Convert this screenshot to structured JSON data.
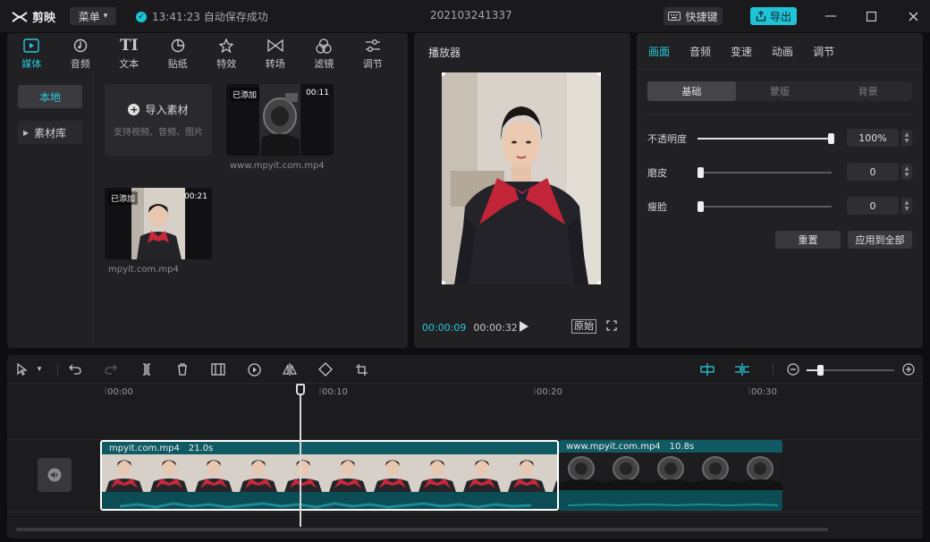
{
  "titlebar": {
    "app_name": "剪映",
    "menu_label": "菜单",
    "autosave_text": "13:41:23 自动保存成功",
    "project_name": "202103241337",
    "shortcut_label": "快捷键",
    "export_label": "导出"
  },
  "media": {
    "tabs": [
      {
        "label": "媒体",
        "icon": "media-icon",
        "active": true
      },
      {
        "label": "音频",
        "icon": "audio-icon"
      },
      {
        "label": "文本",
        "icon": "text-icon"
      },
      {
        "label": "贴纸",
        "icon": "sticker-icon"
      },
      {
        "label": "特效",
        "icon": "effects-icon"
      },
      {
        "label": "转场",
        "icon": "transition-icon"
      },
      {
        "label": "滤镜",
        "icon": "filter-icon"
      },
      {
        "label": "调节",
        "icon": "adjust-icon"
      }
    ],
    "side": {
      "local": "本地",
      "library": "素材库"
    },
    "import": {
      "title": "导入素材",
      "hint": "支持视频、音频、图片"
    },
    "items": [
      {
        "badge": "已添加",
        "duration": "00:11",
        "filename": "www.mpyit.com.mp4"
      },
      {
        "badge": "已添加",
        "duration": "00:21",
        "filename": "mpyit.com.mp4"
      }
    ]
  },
  "player": {
    "title": "播放器",
    "current_time": "00:00:09",
    "total_time": "00:00:32",
    "original_label": "原始"
  },
  "properties": {
    "tabs": [
      "画面",
      "音频",
      "变速",
      "动画",
      "调节"
    ],
    "subtabs": [
      "基础",
      "蒙版",
      "背景"
    ],
    "rows": [
      {
        "label": "不透明度",
        "value": "100%",
        "level": 1.0
      },
      {
        "label": "磨皮",
        "value": "0",
        "level": 0
      },
      {
        "label": "瘦脸",
        "value": "0",
        "level": 0
      }
    ],
    "reset_label": "重置",
    "apply_all_label": "应用到全部"
  },
  "timeline": {
    "ruler": [
      "00:00",
      "00:10",
      "00:20",
      "00:30"
    ],
    "clips": [
      {
        "name": "mpyit.com.mp4",
        "duration": "21.0s"
      },
      {
        "name": "www.mpyit.com.mp4",
        "duration": "10.8s"
      }
    ]
  },
  "colors": {
    "accent": "#27c8db",
    "clip_teal": "#0f5a63"
  }
}
